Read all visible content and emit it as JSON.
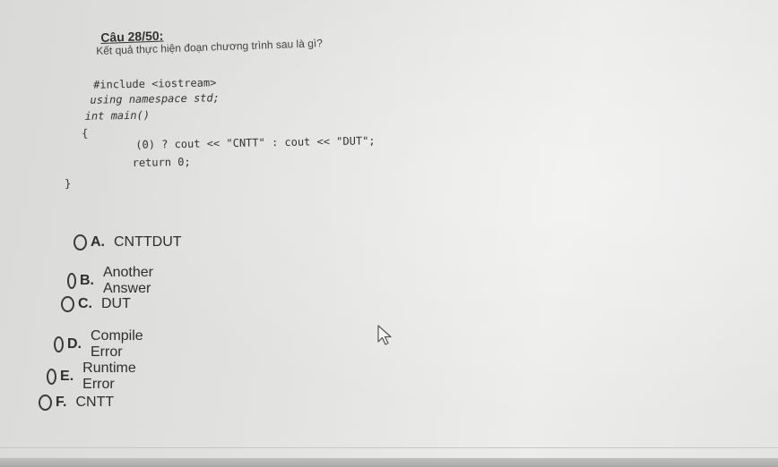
{
  "question": {
    "header": "Câu 28/50:",
    "text": "Kết quả thực hiện đoạn chương trình sau là gì?"
  },
  "code": {
    "line1": "#include <iostream>",
    "line2": "using namespace std;",
    "line3": "int main()",
    "line4": "{",
    "line5": "(0) ? cout << \"CNTT\" : cout << \"DUT\";",
    "line6": "return 0;",
    "line7": "}"
  },
  "options": [
    {
      "letter": "A.",
      "text": "CNTTDUT"
    },
    {
      "letter": "B.",
      "text": "Another Answer"
    },
    {
      "letter": "C.",
      "text": "DUT"
    },
    {
      "letter": "D.",
      "text": "Compile Error"
    },
    {
      "letter": "E.",
      "text": "Runtime Error"
    },
    {
      "letter": "F.",
      "text": "CNTT"
    }
  ],
  "icons": {
    "radio": "radio-unselected-icon",
    "cursor": "mouse-pointer-icon"
  }
}
